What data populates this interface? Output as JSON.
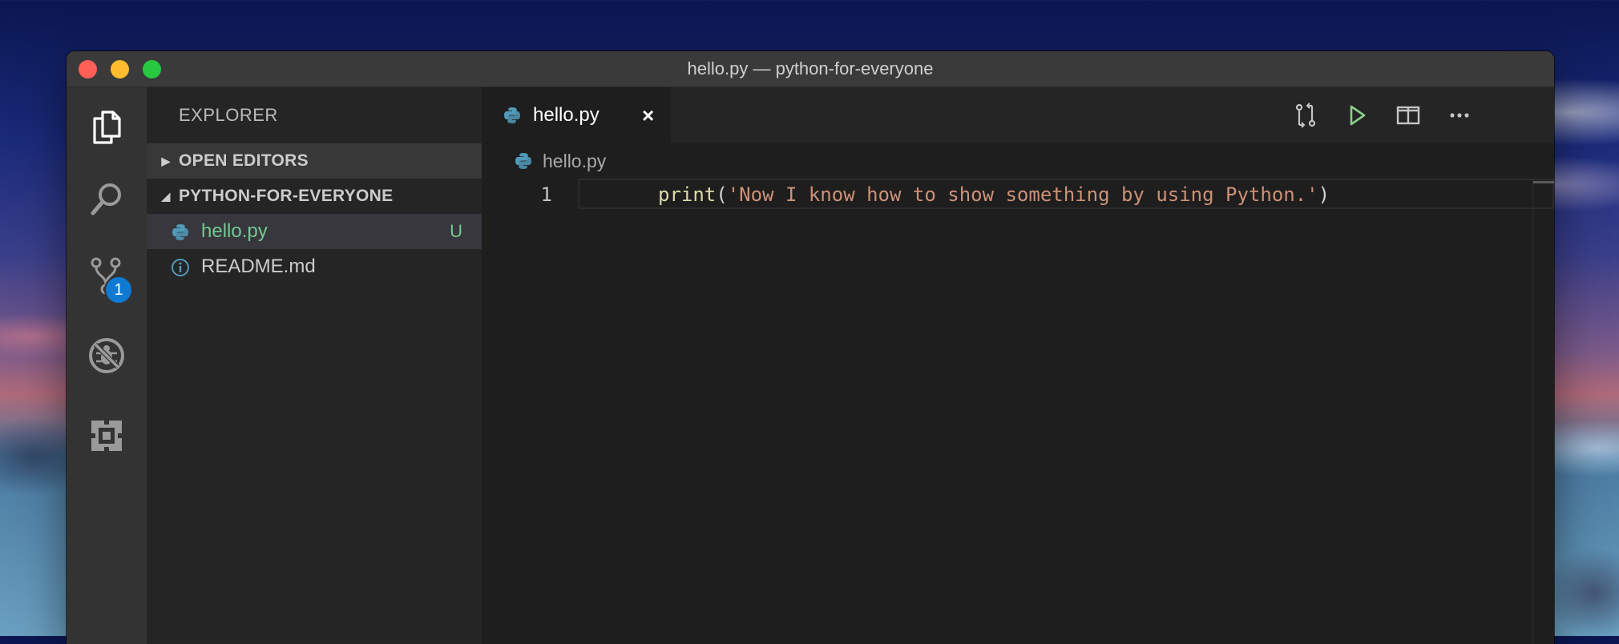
{
  "window": {
    "title": "hello.py — python-for-everyone"
  },
  "activity_bar": {
    "items": [
      {
        "name": "explorer",
        "icon": "files-icon"
      },
      {
        "name": "search",
        "icon": "search-icon"
      },
      {
        "name": "source-control",
        "icon": "source-control-icon",
        "badge": "1"
      },
      {
        "name": "debug",
        "icon": "no-bug-icon"
      },
      {
        "name": "extensions",
        "icon": "extensions-icon"
      }
    ]
  },
  "sidebar": {
    "title": "EXPLORER",
    "sections": {
      "open_editors": "OPEN EDITORS",
      "project": "PYTHON-FOR-EVERYONE"
    },
    "files": [
      {
        "name": "hello.py",
        "status": "U",
        "icon": "python-icon"
      },
      {
        "name": "README.md",
        "status": "",
        "icon": "info-icon"
      }
    ]
  },
  "editor": {
    "tab": {
      "name": "hello.py",
      "close": "×"
    },
    "breadcrumb": "hello.py",
    "lines": [
      {
        "number": "1",
        "fn": "print",
        "open": "(",
        "string": "'Now I know how to show something by using Python.'",
        "close": ")"
      }
    ]
  },
  "colors": {
    "accent": "#0e7ad3",
    "untracked": "#73c991",
    "string": "#ce9178",
    "function": "#dcdcaa",
    "run": "#89d185"
  }
}
